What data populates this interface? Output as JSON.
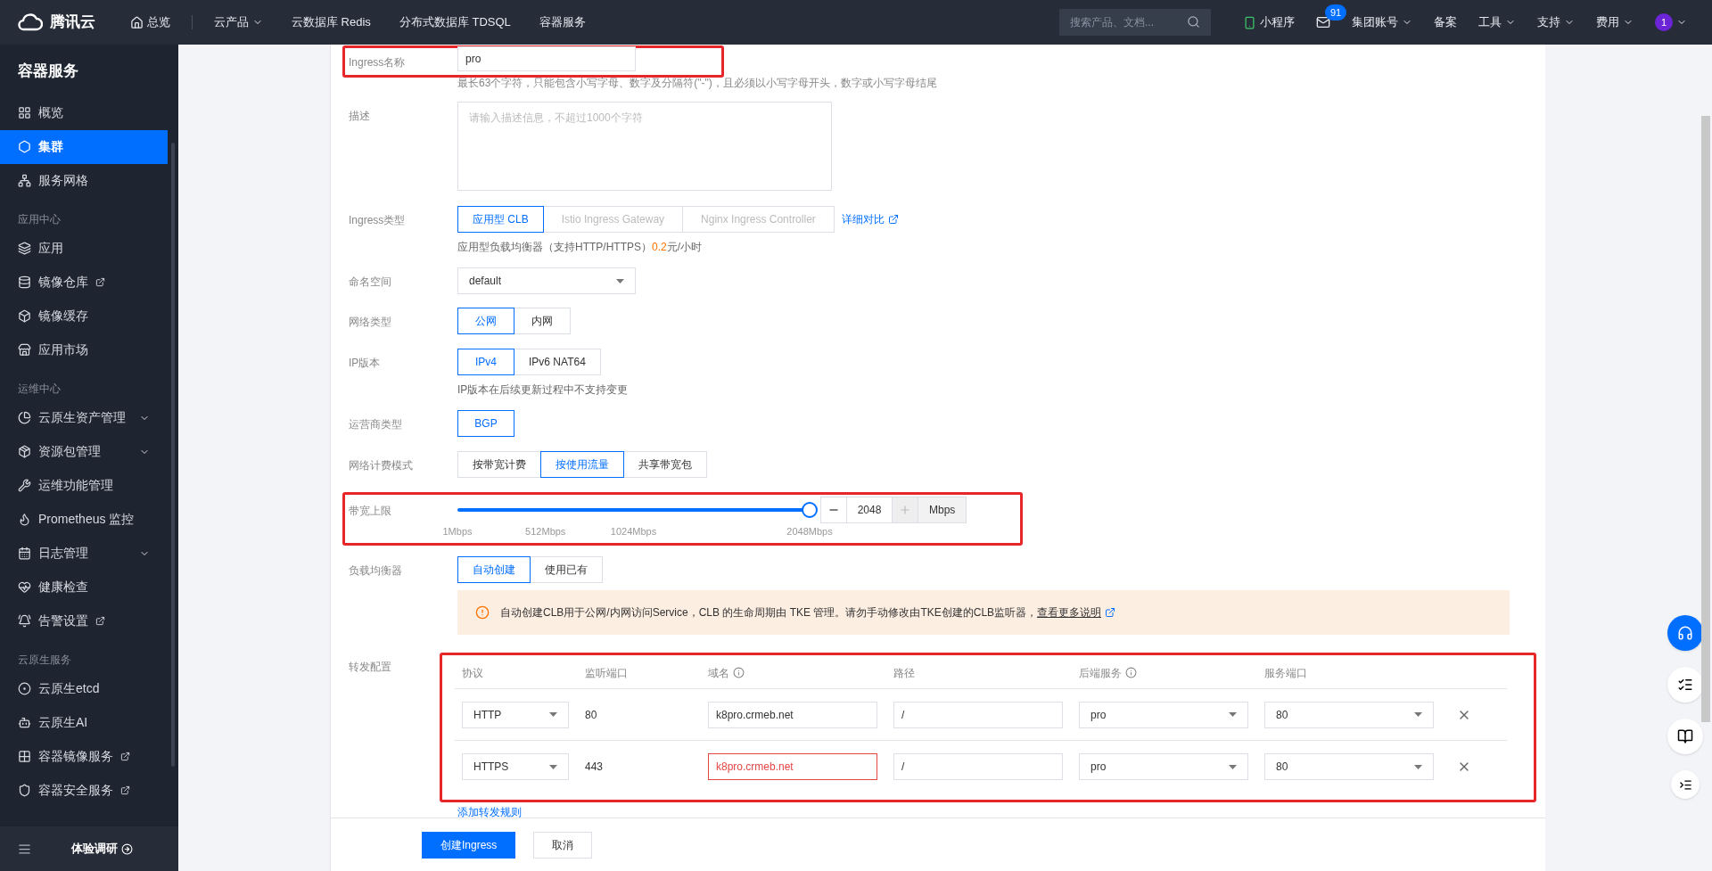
{
  "topbar": {
    "logo": "腾讯云",
    "nav": [
      {
        "label": "总览",
        "kind": "home"
      },
      {
        "label": "云产品",
        "kind": "dropdown"
      },
      {
        "label": "云数据库 Redis",
        "kind": "plain"
      },
      {
        "label": "分布式数据库 TDSQL",
        "kind": "plain"
      },
      {
        "label": "容器服务",
        "kind": "plain"
      }
    ],
    "search": {
      "placeholder": "搜索产品、文档..."
    },
    "right": [
      {
        "label": "小程序",
        "kind": "miniapp"
      },
      {
        "label": "91",
        "kind": "mail"
      },
      {
        "label": "集团账号",
        "kind": "dropdown"
      },
      {
        "label": "备案",
        "kind": "plain"
      },
      {
        "label": "工具",
        "kind": "dropdown"
      },
      {
        "label": "支持",
        "kind": "dropdown"
      },
      {
        "label": "费用",
        "kind": "dropdown"
      },
      {
        "label": "1",
        "kind": "avatar"
      }
    ]
  },
  "sidebar": {
    "title": "容器服务",
    "groups": [
      {
        "items": [
          {
            "label": "概览",
            "selected": false
          },
          {
            "label": "集群",
            "selected": true
          },
          {
            "label": "服务网格",
            "selected": false
          }
        ]
      },
      {
        "heading": "应用中心",
        "items": [
          {
            "label": "应用",
            "selected": false
          },
          {
            "label": "镜像仓库",
            "selected": false,
            "external": true
          },
          {
            "label": "镜像缓存",
            "selected": false
          },
          {
            "label": "应用市场",
            "selected": false
          }
        ]
      },
      {
        "heading": "运维中心",
        "items": [
          {
            "label": "云原生资产管理",
            "selected": false,
            "expandable": true
          },
          {
            "label": "资源包管理",
            "selected": false,
            "expandable": true
          },
          {
            "label": "运维功能管理",
            "selected": false
          },
          {
            "label": "Prometheus 监控",
            "selected": false
          },
          {
            "label": "日志管理",
            "selected": false,
            "expandable": true
          },
          {
            "label": "健康检查",
            "selected": false
          },
          {
            "label": "告警设置",
            "selected": false,
            "external": true
          }
        ]
      },
      {
        "heading": "云原生服务",
        "items": [
          {
            "label": "云原生etcd",
            "selected": false
          },
          {
            "label": "云原生AI",
            "selected": false
          },
          {
            "label": "容器镜像服务",
            "selected": false,
            "external": true
          },
          {
            "label": "容器安全服务",
            "selected": false,
            "external": true
          }
        ]
      }
    ],
    "footer": "体验调研"
  },
  "form": [
    {
      "kind": "input",
      "label": "Ingress名称",
      "value": "pro",
      "hint": "最长63个字符，只能包含小写字母、数字及分隔符(\"-\")，且必须以小写字母开头，数字或小写字母结尾",
      "highlighted": true
    },
    {
      "kind": "textarea",
      "label": "描述",
      "placeholder": "请输入描述信息，不超过1000个字符"
    },
    {
      "kind": "segmented",
      "label": "Ingress类型",
      "options": [
        {
          "label": "应用型 CLB",
          "selected": true,
          "disabled": false
        },
        {
          "label": "Istio Ingress Gateway",
          "selected": false,
          "disabled": true
        },
        {
          "label": "Nginx Ingress Controller",
          "selected": false,
          "disabled": true
        }
      ],
      "link": "详细对比",
      "hint": "应用型负载均衡器（支持HTTP/HTTPS）",
      "price": "0.2",
      "unit": "元/小时"
    },
    {
      "kind": "select",
      "label": "命名空间",
      "value": "default"
    },
    {
      "kind": "segmented",
      "label": "网络类型",
      "options": [
        {
          "label": "公网",
          "selected": true,
          "disabled": false
        },
        {
          "label": "内网",
          "selected": false,
          "disabled": false
        }
      ]
    },
    {
      "kind": "segmented",
      "label": "IP版本",
      "options": [
        {
          "label": "IPv4",
          "selected": true,
          "disabled": false
        },
        {
          "label": "IPv6 NAT64",
          "selected": false,
          "disabled": false
        }
      ],
      "hint": "IP版本在后续更新过程中不支持变更"
    },
    {
      "kind": "segmented",
      "label": "运营商类型",
      "options": [
        {
          "label": "BGP",
          "selected": true,
          "disabled": false
        }
      ]
    },
    {
      "kind": "segmented",
      "label": "网络计费模式",
      "options": [
        {
          "label": "按带宽计费",
          "selected": false,
          "disabled": false
        },
        {
          "label": "按使用流量",
          "selected": true,
          "disabled": false
        },
        {
          "label": "共享带宽包",
          "selected": false,
          "disabled": false
        }
      ]
    },
    {
      "kind": "slider",
      "label": "带宽上限",
      "level": 1,
      "ticks": [
        "1Mbps",
        "512Mbps",
        "1024Mbps",
        "2048Mbps"
      ],
      "value": "2048",
      "unit": "Mbps",
      "plus_disabled": true,
      "highlighted": true
    },
    {
      "kind": "segmented",
      "label": "负载均衡器",
      "options": [
        {
          "label": "自动创建",
          "selected": true,
          "disabled": false
        },
        {
          "label": "使用已有",
          "selected": false,
          "disabled": false
        }
      ],
      "notice": "自动创建CLB用于公网/内网访问Service，CLB 的生命周期由 TKE 管理。请勿手动修改由TKE创建的CLB监听器，",
      "notice_link": "查看更多说明"
    },
    {
      "kind": "table",
      "label": "转发配置",
      "highlighted": true,
      "columns": [
        {
          "label": "协议",
          "info": false
        },
        {
          "label": "监听端口",
          "info": false
        },
        {
          "label": "域名",
          "info": true
        },
        {
          "label": "路径",
          "info": false
        },
        {
          "label": "后端服务",
          "info": true
        },
        {
          "label": "服务端口",
          "info": false
        }
      ],
      "rows": [
        {
          "protocol": "HTTP",
          "port": "80",
          "domain": "k8pro.crmeb.net",
          "domain_error": false,
          "path": "/",
          "backend": "pro",
          "service_port": "80"
        },
        {
          "protocol": "HTTPS",
          "port": "443",
          "domain": "k8pro.crmeb.net",
          "domain_error": true,
          "path": "/",
          "backend": "pro",
          "service_port": "80"
        }
      ],
      "add": "添加转发规则"
    }
  ],
  "actions": [
    {
      "label": "创建Ingress",
      "primary": true
    },
    {
      "label": "取消",
      "primary": false
    }
  ]
}
